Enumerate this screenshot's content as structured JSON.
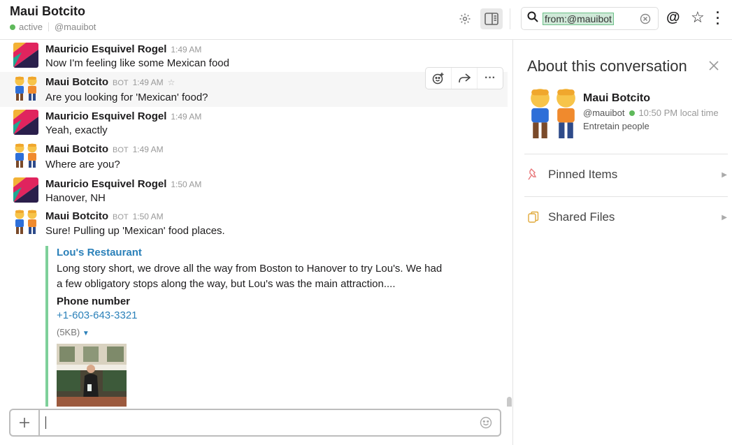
{
  "header": {
    "title": "Maui Botcito",
    "status": "active",
    "handle": "@mauibot",
    "search_value": "from:@mauibot"
  },
  "messages": [
    {
      "author": "Mauricio Esquivel Rogel",
      "time": "1:49 AM",
      "text": "Now I'm feeling like some Mexican food",
      "bot": false
    },
    {
      "author": "Maui Botcito",
      "bot_label": "BOT",
      "time": "1:49 AM",
      "text": "Are you looking for 'Mexican' food?",
      "bot": true
    },
    {
      "author": "Mauricio Esquivel Rogel",
      "time": "1:49 AM",
      "text": "Yeah, exactly",
      "bot": false
    },
    {
      "author": "Maui Botcito",
      "bot_label": "BOT",
      "time": "1:49 AM",
      "text": "Where are you?",
      "bot": true
    },
    {
      "author": "Mauricio Esquivel Rogel",
      "time": "1:50 AM",
      "text": "Hanover, NH",
      "bot": false
    },
    {
      "author": "Maui Botcito",
      "bot_label": "BOT",
      "time": "1:50 AM",
      "text": "Sure! Pulling up 'Mexican' food places.",
      "bot": true
    }
  ],
  "attachment": {
    "title": "Lou's Restaurant",
    "description": "Long story short, we drove all the way from Boston to Hanover to try Lou's. We had a few obligatory stops along the way, but Lou's was the main attraction....",
    "field_label": "Phone number",
    "phone": "+1-603-643-3321",
    "size": "(5KB)"
  },
  "sidebar": {
    "title": "About this conversation",
    "name": "Maui Botcito",
    "handle": "@mauibot",
    "local_time": "10:50 PM local time",
    "description": "Entretain people",
    "pinned_label": "Pinned Items",
    "files_label": "Shared Files"
  },
  "colors": {
    "accent_link": "#2a80b9",
    "presence": "#5fb95b",
    "attachment_bar": "#7ed09a"
  }
}
